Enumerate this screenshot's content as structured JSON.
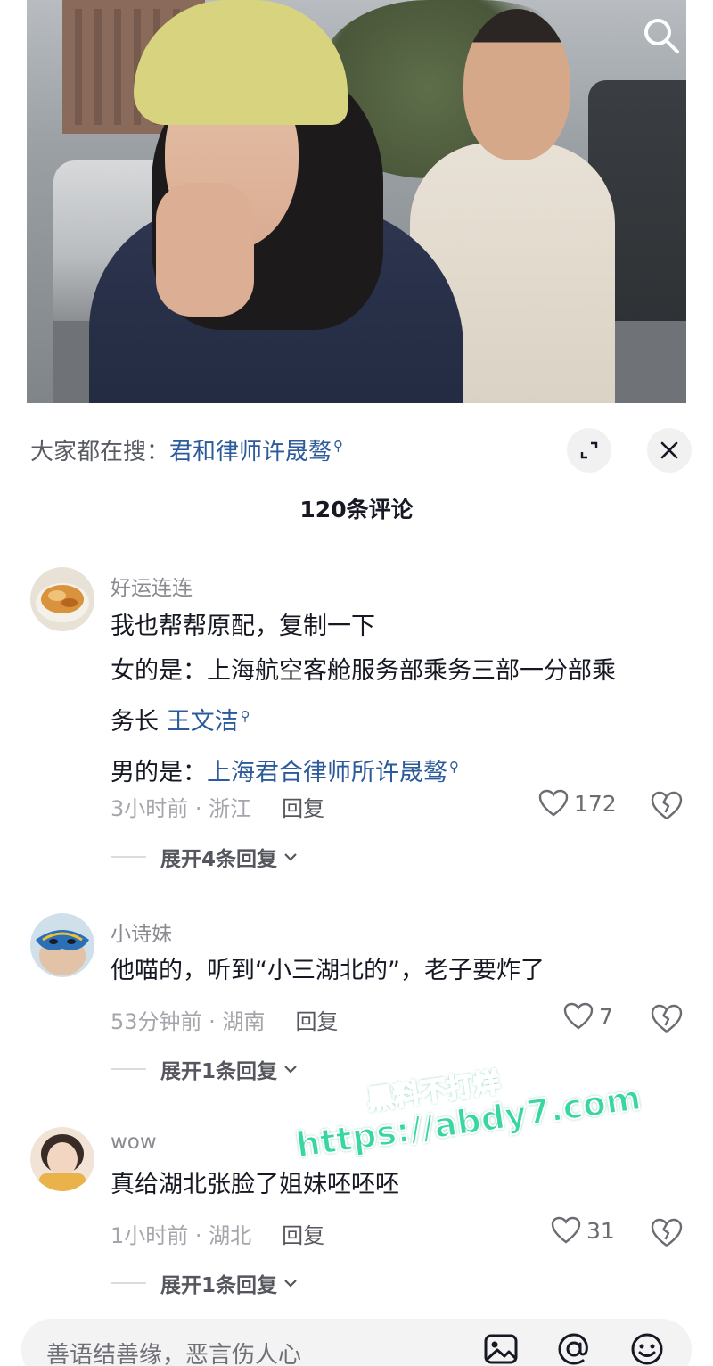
{
  "hot_search": {
    "prefix": "大家都在搜：",
    "term": "君和律师许晟骜",
    "search_glyph": "⚲"
  },
  "comment_count_title": "120条评论",
  "comments": [
    {
      "user": "好运连连",
      "lines": [
        {
          "text": "我也帮帮原配，复制一下"
        },
        {
          "text": "女的是：上海航空客舱服务部乘务三部一分部乘"
        },
        {
          "text": "务长 ",
          "link": "王文洁"
        },
        {
          "text": "男的是：",
          "link": "上海君合律师所许晟骜"
        }
      ],
      "time_location": "3小时前 · 浙江",
      "reply_label": "回复",
      "likes": "172",
      "expand_label": "展开4条回复"
    },
    {
      "user": "小诗妹",
      "lines": [
        {
          "text": "他喵的，听到“小三湖北的”，老子要炸了"
        }
      ],
      "time_location": "53分钟前 · 湖南",
      "reply_label": "回复",
      "likes": "7",
      "expand_label": "展开1条回复"
    },
    {
      "user": "wow",
      "lines": [
        {
          "text": "真给湖北张脸了姐妹呸呸呸"
        }
      ],
      "time_location": "1小时前 · 湖北",
      "reply_label": "回复",
      "likes": "31",
      "expand_label": "展开1条回复"
    }
  ],
  "watermark": {
    "line1": "黑料不打烊",
    "line2": "https://abdy7.com"
  },
  "input": {
    "placeholder": "善语结善缘，恶言伤人心"
  },
  "icons": {
    "search": "search-icon",
    "expand": "expand-icon",
    "close": "close-icon",
    "like": "heart-icon",
    "dislike": "broken-heart-icon",
    "image": "image-icon",
    "mention": "at-icon",
    "emoji": "emoji-icon"
  },
  "colors": {
    "link": "#2c5b9b",
    "muted": "#8a8b91",
    "text": "#161823",
    "watermark": "#39d6a0"
  }
}
